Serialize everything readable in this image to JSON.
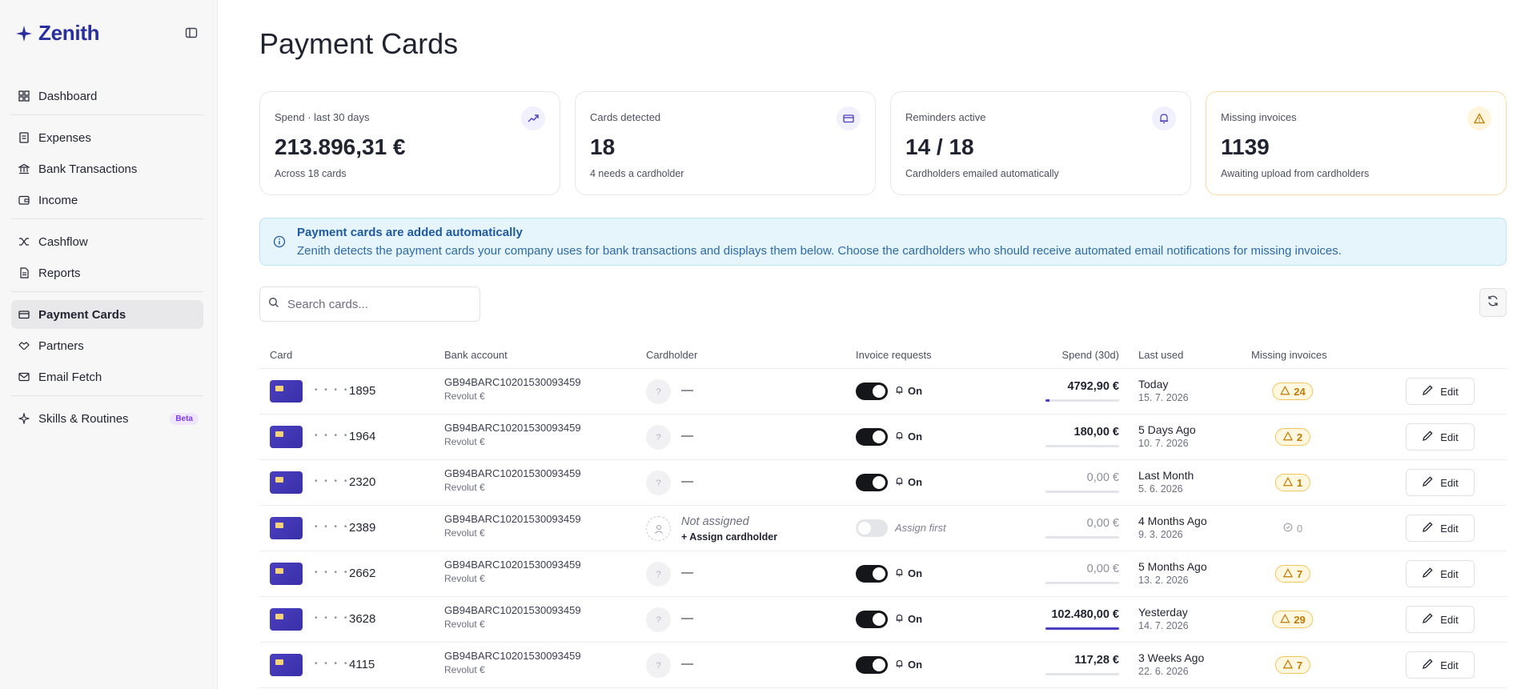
{
  "brand": {
    "name": "Zenith"
  },
  "sidebar": {
    "items": [
      {
        "label": "Dashboard",
        "icon": "dashboard-icon"
      },
      {
        "label": "Expenses",
        "icon": "receipt-icon"
      },
      {
        "label": "Bank Transactions",
        "icon": "bank-icon"
      },
      {
        "label": "Income",
        "icon": "wallet-icon"
      },
      {
        "label": "Cashflow",
        "icon": "shuffle-icon"
      },
      {
        "label": "Reports",
        "icon": "document-icon"
      },
      {
        "label": "Payment Cards",
        "icon": "credit-card-icon",
        "active": true
      },
      {
        "label": "Partners",
        "icon": "handshake-icon"
      },
      {
        "label": "Email Fetch",
        "icon": "mail-icon"
      },
      {
        "label": "Skills & Routines",
        "icon": "sparkle-icon",
        "badge": "Beta"
      }
    ]
  },
  "page": {
    "title": "Payment Cards"
  },
  "stats": [
    {
      "label": "Spend · last 30 days",
      "value": "213.896,31 €",
      "sub": "Across 18 cards",
      "icon": "trending-up-icon"
    },
    {
      "label": "Cards detected",
      "value": "18",
      "sub": "4 needs a cardholder",
      "icon": "credit-card-icon"
    },
    {
      "label": "Reminders active",
      "value": "14 / 18",
      "sub": "Cardholders emailed automatically",
      "icon": "bell-icon"
    },
    {
      "label": "Missing invoices",
      "value": "1139",
      "sub": "Awaiting upload from cardholders",
      "icon": "warning-icon"
    }
  ],
  "banner": {
    "title": "Payment cards are added automatically",
    "text": "Zenith detects the payment cards your company uses for bank transactions and displays them below. Choose the cardholders who should receive automated email notifications for missing invoices."
  },
  "search": {
    "placeholder": "Search cards..."
  },
  "table": {
    "headers": {
      "card": "Card",
      "bank": "Bank account",
      "holder": "Cardholder",
      "invoice": "Invoice requests",
      "spend": "Spend (30d)",
      "last": "Last used",
      "missing": "Missing invoices"
    },
    "edit_label": "Edit",
    "rows": [
      {
        "dots": "• • • •",
        "last4": "1895",
        "iban": "GB94BARC10201530093459",
        "bank": "Revolut €",
        "holder": "—",
        "avatar": "?",
        "assigned": true,
        "invoice_on": true,
        "invoice": "On",
        "spend": "4792,90 €",
        "spend_fraction": 0.05,
        "last_used": "Today",
        "last_date": "15. 7. 2026",
        "missing": "24"
      },
      {
        "dots": "• • • •",
        "last4": "1964",
        "iban": "GB94BARC10201530093459",
        "bank": "Revolut €",
        "holder": "—",
        "avatar": "?",
        "assigned": true,
        "invoice_on": true,
        "invoice": "On",
        "spend": "180,00 €",
        "spend_fraction": 0.0,
        "last_used": "5 Days Ago",
        "last_date": "10. 7. 2026",
        "missing": "2"
      },
      {
        "dots": "• • • •",
        "last4": "2320",
        "iban": "GB94BARC10201530093459",
        "bank": "Revolut €",
        "holder": "—",
        "avatar": "?",
        "assigned": true,
        "invoice_on": true,
        "invoice": "On",
        "spend": "0,00 €",
        "spend_fraction": 0.0,
        "last_used": "Last Month",
        "last_date": "5. 6. 2026",
        "missing": "1"
      },
      {
        "dots": "• • • •",
        "last4": "2389",
        "iban": "GB94BARC10201530093459",
        "bank": "Revolut €",
        "holder": "Not assigned",
        "assign_label": "+ Assign cardholder",
        "assigned": false,
        "invoice_on": false,
        "invoice": "Assign first",
        "spend": "0,00 €",
        "spend_fraction": 0.0,
        "last_used": "4 Months Ago",
        "last_date": "9. 3. 2026",
        "missing": "0"
      },
      {
        "dots": "• • • •",
        "last4": "2662",
        "iban": "GB94BARC10201530093459",
        "bank": "Revolut €",
        "holder": "—",
        "avatar": "?",
        "assigned": true,
        "invoice_on": true,
        "invoice": "On",
        "spend": "0,00 €",
        "spend_fraction": 0.0,
        "last_used": "5 Months Ago",
        "last_date": "13. 2. 2026",
        "missing": "7"
      },
      {
        "dots": "• • • •",
        "last4": "3628",
        "iban": "GB94BARC10201530093459",
        "bank": "Revolut €",
        "holder": "—",
        "avatar": "?",
        "assigned": true,
        "invoice_on": true,
        "invoice": "On",
        "spend": "102.480,00 €",
        "spend_fraction": 1.0,
        "last_used": "Yesterday",
        "last_date": "14. 7. 2026",
        "missing": "29"
      },
      {
        "dots": "• • • •",
        "last4": "4115",
        "iban": "GB94BARC10201530093459",
        "bank": "Revolut €",
        "holder": "—",
        "avatar": "?",
        "assigned": true,
        "invoice_on": true,
        "invoice": "On",
        "spend": "117,28 €",
        "spend_fraction": 0.0,
        "last_used": "3 Weeks Ago",
        "last_date": "22. 6. 2026",
        "missing": "7"
      }
    ]
  },
  "colors": {
    "brand": "#2a2f9e",
    "accent": "#4a3fc0",
    "warning": "#c07a00",
    "info": "#1e5aa0"
  }
}
